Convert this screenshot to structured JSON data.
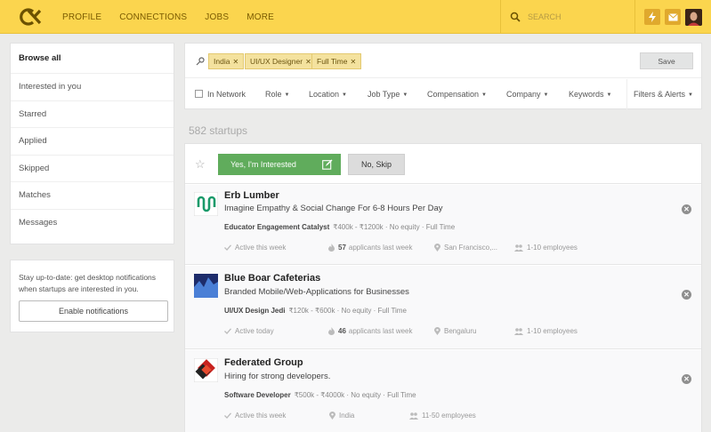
{
  "nav": {
    "profile": "PROFILE",
    "connections": "CONNECTIONS",
    "jobs": "JOBS",
    "more": "MORE"
  },
  "search": {
    "placeholder": "SEARCH"
  },
  "sidebar": {
    "items": [
      {
        "label": "Browse all"
      },
      {
        "label": "Interested in you"
      },
      {
        "label": "Starred"
      },
      {
        "label": "Applied"
      },
      {
        "label": "Skipped"
      },
      {
        "label": "Matches"
      },
      {
        "label": "Messages"
      }
    ]
  },
  "notify": {
    "text": "Stay up-to-date: get desktop notifications when startups are interested in you.",
    "button": "Enable notifications"
  },
  "filters": {
    "tags": [
      "India",
      "UI/UX Designer",
      "Full Time"
    ],
    "save": "Save",
    "in_network": "In Network",
    "role": "Role",
    "location": "Location",
    "job_type": "Job Type",
    "compensation": "Compensation",
    "company": "Company",
    "keywords": "Keywords",
    "filters_alerts": "Filters & Alerts"
  },
  "results": {
    "count": "582 startups",
    "yes": "Yes, I'm Interested",
    "no": "No, Skip",
    "cards": [
      {
        "name": "Erb Lumber",
        "tagline": "Imagine Empathy & Social Change For 6-8 Hours Per Day",
        "job_title": "Educator Engagement Catalyst",
        "job_details": "₹400k - ₹1200k · No equity · Full Time",
        "activity": "Active this week",
        "applicants_count": "57",
        "applicants_text": "applicants last week",
        "location": "San Francisco,...",
        "size": "1-10 employees"
      },
      {
        "name": "Blue Boar Cafeterias",
        "tagline": "Branded Mobile/Web-Applications for Businesses",
        "job_title": "UI/UX Design Jedi",
        "job_details": "₹120k - ₹600k · No equity · Full Time",
        "activity": "Active today",
        "applicants_count": "46",
        "applicants_text": "applicants last week",
        "location": "Bengaluru",
        "size": "1-10 employees"
      },
      {
        "name": "Federated Group",
        "tagline": "Hiring for strong developers.",
        "job_title": "Software Developer",
        "job_details": "₹500k - ₹4000k · No equity · Full Time",
        "activity": "Active this week",
        "location": "India",
        "size": "11-50 employees"
      }
    ]
  },
  "colors": {
    "brand": "#fbd54e",
    "accent_green": "#60ac5c"
  },
  "icons": [
    "logo-icon",
    "search-icon",
    "lightning-icon",
    "mail-icon",
    "key-icon",
    "star-icon",
    "edit-icon",
    "check-icon",
    "fire-icon",
    "pin-icon",
    "people-icon",
    "close-icon"
  ]
}
